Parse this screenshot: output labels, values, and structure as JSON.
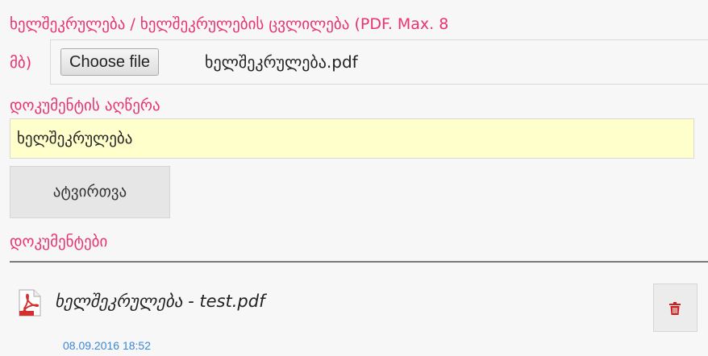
{
  "form": {
    "upload_label_line1": "ხელშეკრულება / ხელშეკრულების ცვლილება (PDF. Max. 8",
    "upload_label_line2": "მბ)",
    "choose_file_label": "Choose file",
    "selected_file_name": "ხელშეკრულება.pdf",
    "description_label": "დოკუმენტის აღწერა",
    "description_value": "ხელშეკრულება",
    "upload_button_label": "ატვირთვა"
  },
  "documents": {
    "section_label": "დოკუმენტები",
    "items": [
      {
        "title": "ხელშეკრულება - test.pdf",
        "date": "08.09.2016 18:52",
        "icon": "pdf-file-icon",
        "delete_icon": "trash-icon"
      }
    ]
  },
  "colors": {
    "accent_pink": "#e8336e",
    "input_highlight": "#ffffcc",
    "date_blue": "#3a87d8",
    "pdf_red": "#d32f2f",
    "delete_red": "#cc1f1f"
  }
}
